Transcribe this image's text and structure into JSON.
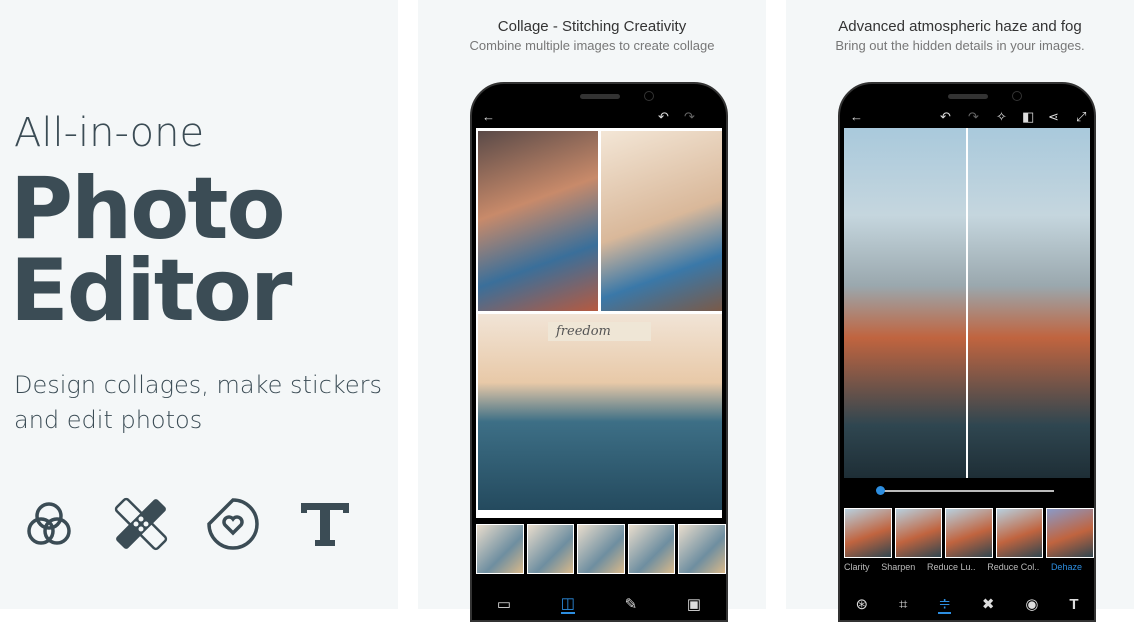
{
  "promo": {
    "line1": "All-in-one",
    "line2": "Photo",
    "line3": "Editor",
    "subtitle1": "Design collages, make stickers",
    "subtitle2": "and edit photos",
    "icons": [
      "color-circles-icon",
      "bandage-heal-icon",
      "sticker-heart-icon",
      "text-icon"
    ]
  },
  "collage": {
    "title": "Collage - Stitching Creativity",
    "subtitle": "Combine multiple images to create collage",
    "sticker_text": "freedom",
    "nav": [
      "aspect-icon",
      "layout-icon",
      "pencil-icon",
      "border-icon"
    ]
  },
  "haze": {
    "title": "Advanced atmospheric haze and fog",
    "subtitle": "Bring out the hidden details in your images.",
    "slider_value": 0,
    "filters": [
      {
        "label": "Clarity"
      },
      {
        "label": "Sharpen"
      },
      {
        "label": "Reduce Lu.."
      },
      {
        "label": "Reduce Col.."
      },
      {
        "label": "Dehaze",
        "active": true
      }
    ],
    "nav": [
      "looks-icon",
      "crop-icon",
      "adjust-icon",
      "heal-icon",
      "eye-icon",
      "text-icon"
    ]
  },
  "colors": {
    "text": "#3b4c55",
    "accent": "#2d8ee0",
    "panel": "#f4f7f8"
  }
}
